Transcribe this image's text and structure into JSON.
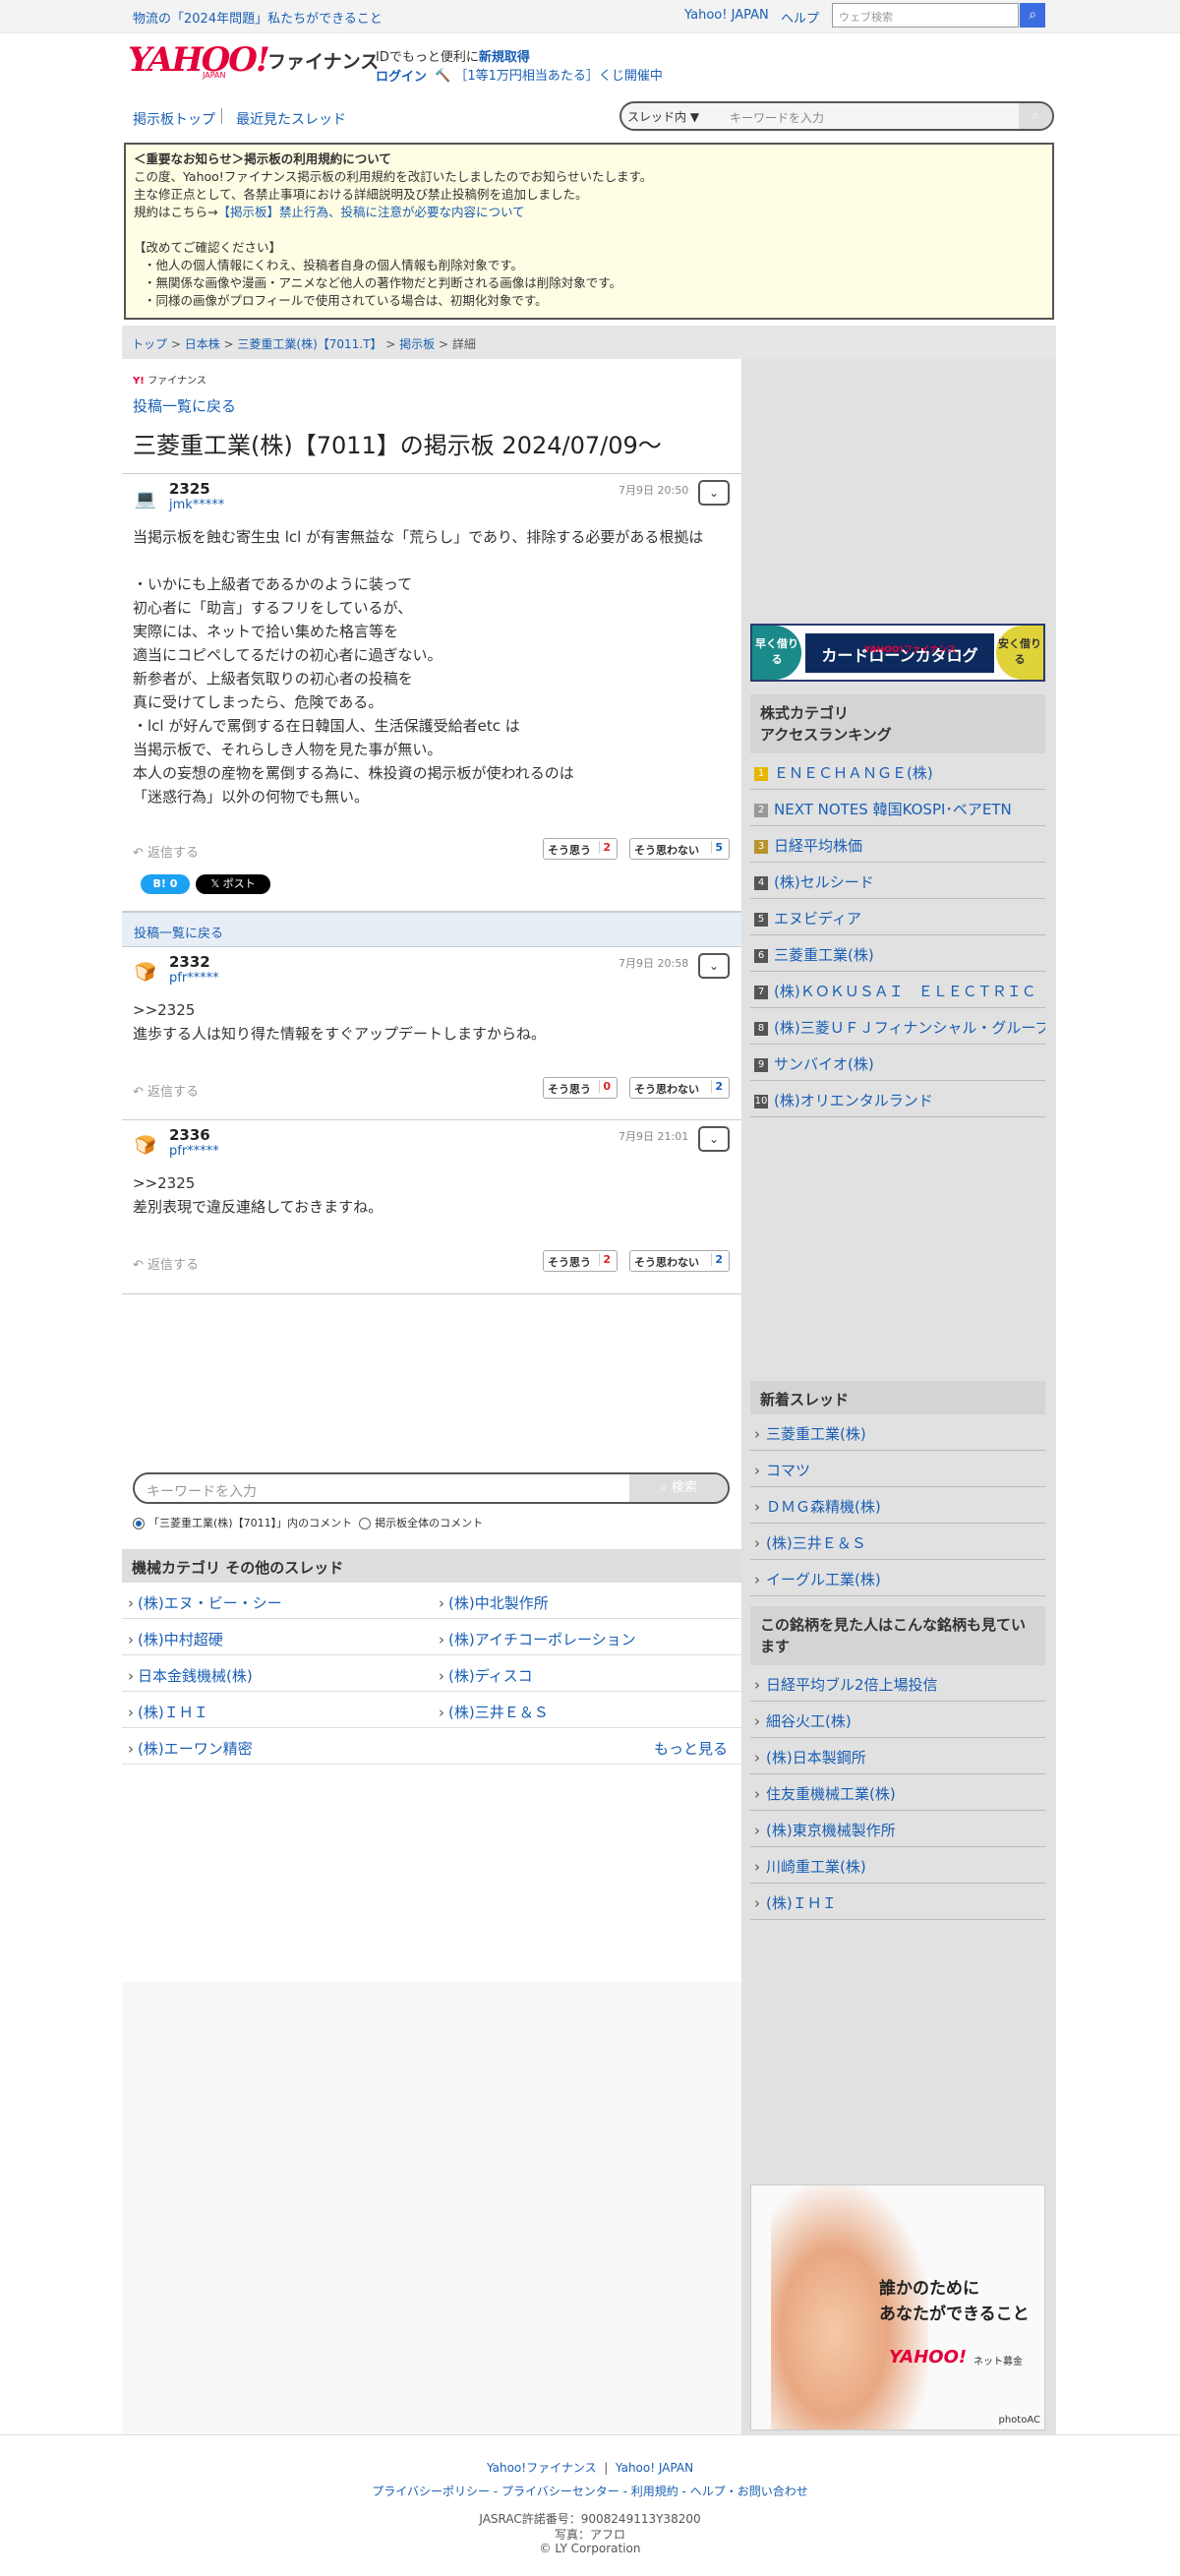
{
  "topbar": {
    "promo": "物流の「2024年問題」私たちができること",
    "link_yahoo": "Yahoo! JAPAN",
    "link_help": "ヘルプ",
    "search_placeholder": "ウェブ検索"
  },
  "header": {
    "logo": "YAHOO!",
    "logo_sub": "JAPAN",
    "service": "ファイナンス",
    "id_text": "IDでもっと便利に",
    "id_link": "新規取得",
    "login": "ログイン",
    "lotto": "［1等1万円相当あたる］くじ開催中"
  },
  "nav": {
    "board_top": "掲示板トップ",
    "recent": "最近見たスレッド",
    "scope": "スレッド内 ▼",
    "keyword_placeholder": "キーワードを入力"
  },
  "notice": {
    "title": "＜重要なお知らせ＞掲示板の利用規約について",
    "line1": "この度、Yahoo!ファイナンス掲示板の利用規約を改訂いたしましたのでお知らせいたします。",
    "line2": "主な修正点として、各禁止事項における詳細説明及び禁止投稿例を追加しました。",
    "line3_pre": "規約はこちら→",
    "line3_link": "【掲示板】禁止行為、投稿に注意が必要な内容について",
    "confirm": "【改めてご確認ください】",
    "b1": "・他人の個人情報にくわえ、投稿者自身の個人情報も削除対象です。",
    "b2": "・無関係な画像や漫画・アニメなど他人の著作物だと判断される画像は削除対象です。",
    "b3": "・同様の画像がプロフィールで使用されている場合は、初期化対象です。"
  },
  "breadcrumb": [
    "トップ",
    "日本株",
    "三菱重工業(株)【7011.T】",
    "掲示板",
    "詳細"
  ],
  "main": {
    "brand_small": "ファイナンス",
    "back": "投稿一覧に戻る",
    "title": "三菱重工業(株)【7011】の掲示板 2024/07/09〜",
    "back2": "投稿一覧に戻る"
  },
  "posts": [
    {
      "no": "2325",
      "user": "jmk*****",
      "date": "7月9日 20:50",
      "body": "当掲示板を蝕む寄生虫 lcl が有害無益な「荒らし」であり、排除する必要がある根拠は\n\n・いかにも上級者であるかのように装って\n初心者に「助言」するフリをしているが、\n実際には、ネットで拾い集めた格言等を\n適当にコピペしてるだけの初心者に過ぎない。\n新参者が、上級者気取りの初心者の投稿を\n真に受けてしまったら、危険である。\n・lcl が好んで罵倒する在日韓国人、生活保護受給者etc は\n当掲示板で、それらしき人物を見た事が無い。\n本人の妄想の産物を罵倒する為に、株投資の掲示板が使われるのは\n「迷惑行為」以外の何物でも無い。",
      "reply": "返信する",
      "agree": "そう思う",
      "agree_n": "2",
      "disagree": "そう思わない",
      "disagree_n": "5"
    },
    {
      "no": "2332",
      "user": "pfr*****",
      "date": "7月9日 20:58",
      "body": ">>2325\n進歩する人は知り得た情報をすぐアップデートしますからね。",
      "reply": "返信する",
      "agree": "そう思う",
      "agree_n": "0",
      "disagree": "そう思わない",
      "disagree_n": "2"
    },
    {
      "no": "2336",
      "user": "pfr*****",
      "date": "7月9日 21:01",
      "body": ">>2325\n差別表現で違反連絡しておきますね。",
      "reply": "返信する",
      "agree": "そう思う",
      "agree_n": "2",
      "disagree": "そう思わない",
      "disagree_n": "2"
    }
  ],
  "share": {
    "bi": "B! 0",
    "x": "𝕏 ポスト"
  },
  "keyword_search": {
    "placeholder": "キーワードを入力",
    "button": "検索",
    "opt1": "「三菱重工業(株)【7011】」内のコメント",
    "opt2": "掲示板全体のコメント"
  },
  "category": {
    "title": "機械カテゴリ  その他のスレッド",
    "items": [
      "(株)エヌ・ビー・シー",
      "(株)中北製作所",
      "(株)中村超硬",
      "(株)アイチコーポレーション",
      "日本金銭機械(株)",
      "(株)ディスコ",
      "(株)ＩＨＩ",
      "(株)三井Ｅ＆Ｓ",
      "(株)エーワン精密"
    ],
    "more": "もっと見る"
  },
  "ad_loan": {
    "left": "早く借りる",
    "brand": "YAHOO!ファイナンス",
    "main": "カードローンカタログ",
    "right": "安く借りる"
  },
  "ranking": {
    "title1": "株式カテゴリ",
    "title2": "アクセスランキング",
    "items": [
      "ＥＮＥＣＨＡＮＧＥ(株)",
      "NEXT NOTES 韓国KOSPI･ベアETN",
      "日経平均株価",
      "(株)セルシード",
      "エヌビディア",
      "三菱重工業(株)",
      "(株)ＫＯＫＵＳＡＩ　ＥＬＥＣＴＲＩＣ",
      "(株)三菱ＵＦＪフィナンシャル・グループ",
      "サンバイオ(株)",
      "(株)オリエンタルランド"
    ]
  },
  "new_threads": {
    "title": "新着スレッド",
    "items": [
      "三菱重工業(株)",
      "コマツ",
      "ＤＭＧ森精機(株)",
      "(株)三井Ｅ＆Ｓ",
      "イーグル工業(株)"
    ]
  },
  "also_viewed": {
    "title": "この銘柄を見た人はこんな銘柄も見ています",
    "items": [
      "日経平均ブル2倍上場投信",
      "細谷火工(株)",
      "(株)日本製鋼所",
      "住友重機械工業(株)",
      "(株)東京機械製作所",
      "川崎重工業(株)",
      "(株)ＩＨＩ"
    ]
  },
  "ad_donate": {
    "line1": "誰かのために",
    "line2": "あなたができること",
    "brand": "YAHOO!",
    "brand_sub": "ネット募金",
    "credit": "photoAC"
  },
  "footer": {
    "l1a": "Yahoo!ファイナンス",
    "l1b": "Yahoo! JAPAN",
    "l2": "プライバシーポリシー  -  プライバシーセンター  -  利用規約  -  ヘルプ・お問い合わせ",
    "l3": "JASRAC許諾番号：9008249113Y38200",
    "l4": "写真：アフロ",
    "l5": "© LY Corporation"
  }
}
